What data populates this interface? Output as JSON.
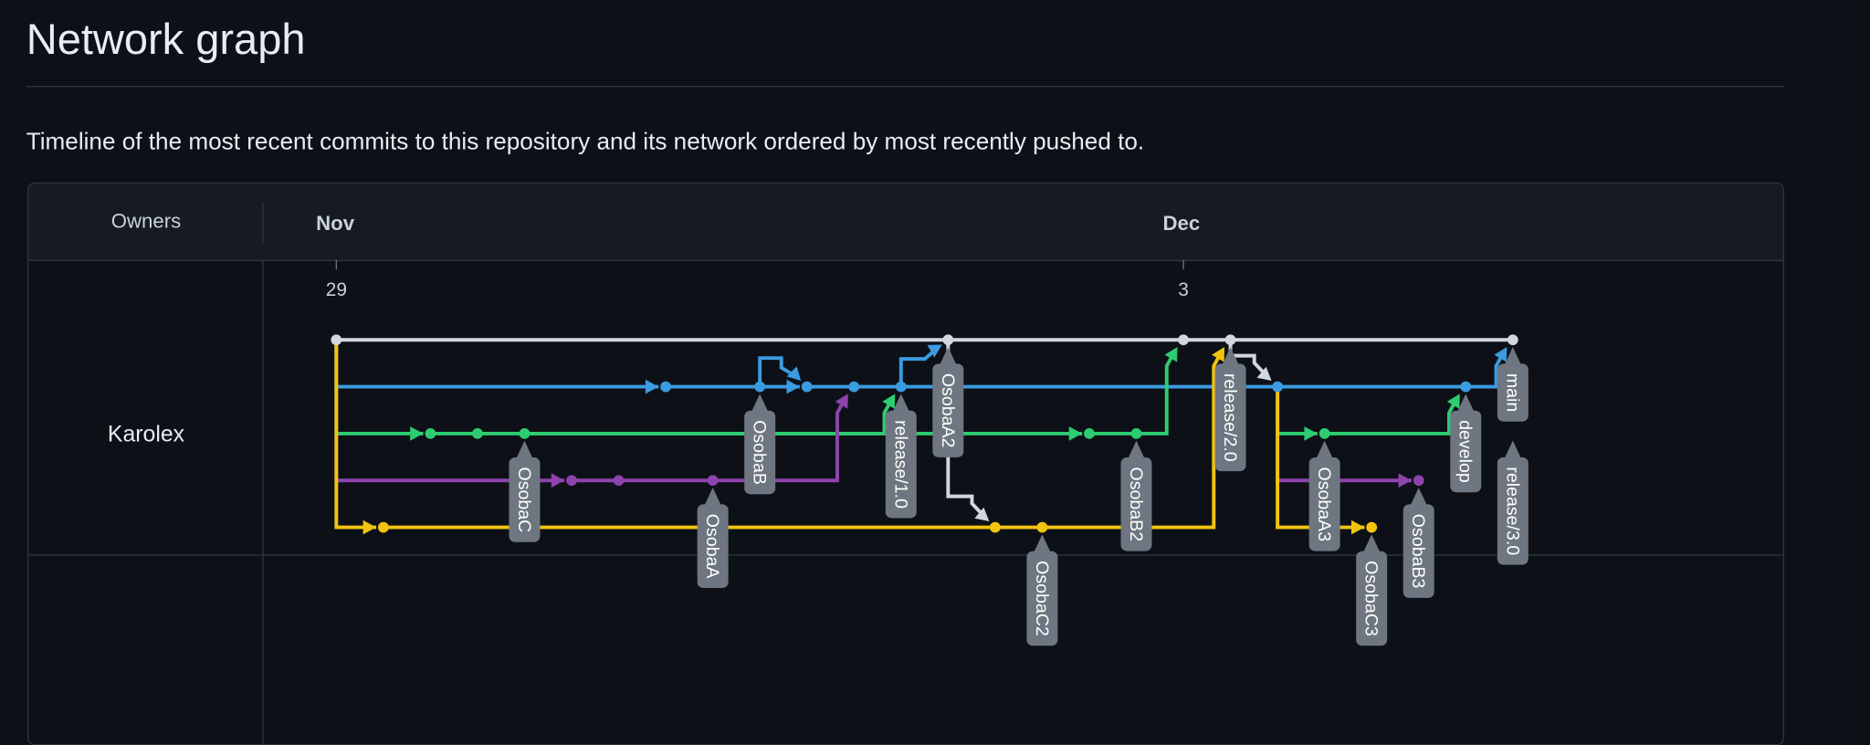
{
  "page": {
    "title": "Network graph",
    "description": "Timeline of the most recent commits to this repository and its network ordered by most recently pushed to."
  },
  "table": {
    "owners_header": "Owners",
    "months": [
      {
        "label": "Nov",
        "col": 0
      },
      {
        "label": "Dec",
        "col": 18
      }
    ],
    "days": [
      {
        "label": "29",
        "col": 0
      },
      {
        "label": "3",
        "col": 18
      }
    ],
    "owners": [
      "Karolex"
    ]
  },
  "colors": {
    "lanes": [
      "#d0d7de",
      "#3b9be0",
      "#2ecc71",
      "#8e44ad",
      "#f1c40f"
    ],
    "label_bg": "#6e7681",
    "label_text": "#ffffff"
  },
  "graph": {
    "commits": [
      [
        0,
        0
      ],
      [
        1,
        4
      ],
      [
        2,
        2
      ],
      [
        3,
        2
      ],
      [
        4,
        2
      ],
      [
        5,
        3
      ],
      [
        6,
        3
      ],
      [
        7,
        1
      ],
      [
        8,
        3
      ],
      [
        9,
        1
      ],
      [
        10,
        1
      ],
      [
        11,
        1
      ],
      [
        12,
        1
      ],
      [
        13,
        0
      ],
      [
        14,
        4
      ],
      [
        15,
        4
      ],
      [
        16,
        2
      ],
      [
        17,
        2
      ],
      [
        18,
        0
      ],
      [
        19,
        0
      ],
      [
        20,
        1
      ],
      [
        21,
        2
      ],
      [
        22,
        4
      ],
      [
        23,
        3
      ],
      [
        24,
        1
      ],
      [
        25,
        0
      ]
    ],
    "edges": [
      [
        0,
        13,
        "h"
      ],
      [
        13,
        18,
        "h"
      ],
      [
        18,
        19,
        "h"
      ],
      [
        19,
        25,
        "h"
      ],
      [
        0,
        7,
        "fork"
      ],
      [
        0,
        2,
        "fork"
      ],
      [
        0,
        5,
        "fork"
      ],
      [
        0,
        1,
        "fork"
      ],
      [
        7,
        9,
        "h"
      ],
      [
        9,
        10,
        "ha"
      ],
      [
        9,
        10,
        "loop"
      ],
      [
        10,
        11,
        "h"
      ],
      [
        11,
        12,
        "h"
      ],
      [
        12,
        20,
        "h"
      ],
      [
        20,
        24,
        "h"
      ],
      [
        24,
        25,
        "up"
      ],
      [
        2,
        3,
        "h"
      ],
      [
        3,
        4,
        "h"
      ],
      [
        4,
        16,
        "ha"
      ],
      [
        16,
        17,
        "h"
      ],
      [
        17,
        18,
        "up"
      ],
      [
        4,
        12,
        "up"
      ],
      [
        21,
        24,
        "up"
      ],
      [
        5,
        6,
        "h"
      ],
      [
        6,
        8,
        "h"
      ],
      [
        8,
        11,
        "up"
      ],
      [
        1,
        14,
        "h"
      ],
      [
        14,
        15,
        "h"
      ],
      [
        15,
        19,
        "up"
      ],
      [
        12,
        13,
        "upv"
      ],
      [
        13,
        14,
        "jog"
      ],
      [
        19,
        20,
        "jog"
      ],
      [
        20,
        21,
        "fork"
      ],
      [
        20,
        23,
        "fork"
      ],
      [
        20,
        22,
        "fork"
      ]
    ],
    "labels": [
      {
        "commit": 4,
        "text": "OsobaC"
      },
      {
        "commit": 8,
        "text": "OsobaA"
      },
      {
        "commit": 9,
        "text": "OsobaB"
      },
      {
        "commit": 12,
        "text": "release/1.0"
      },
      {
        "commit": 13,
        "text": "OsobaA2"
      },
      {
        "commit": 15,
        "text": "OsobaC2"
      },
      {
        "commit": 17,
        "text": "OsobaB2"
      },
      {
        "commit": 19,
        "text": "release/2.0"
      },
      {
        "commit": 21,
        "text": "OsobaA3"
      },
      {
        "commit": 22,
        "text": "OsobaC3"
      },
      {
        "commit": 23,
        "text": "OsobaB3"
      },
      {
        "commit": 24,
        "text": "develop"
      },
      {
        "commit": 25,
        "text": "main"
      },
      {
        "commit": 25,
        "text": "release/3.0"
      }
    ]
  }
}
